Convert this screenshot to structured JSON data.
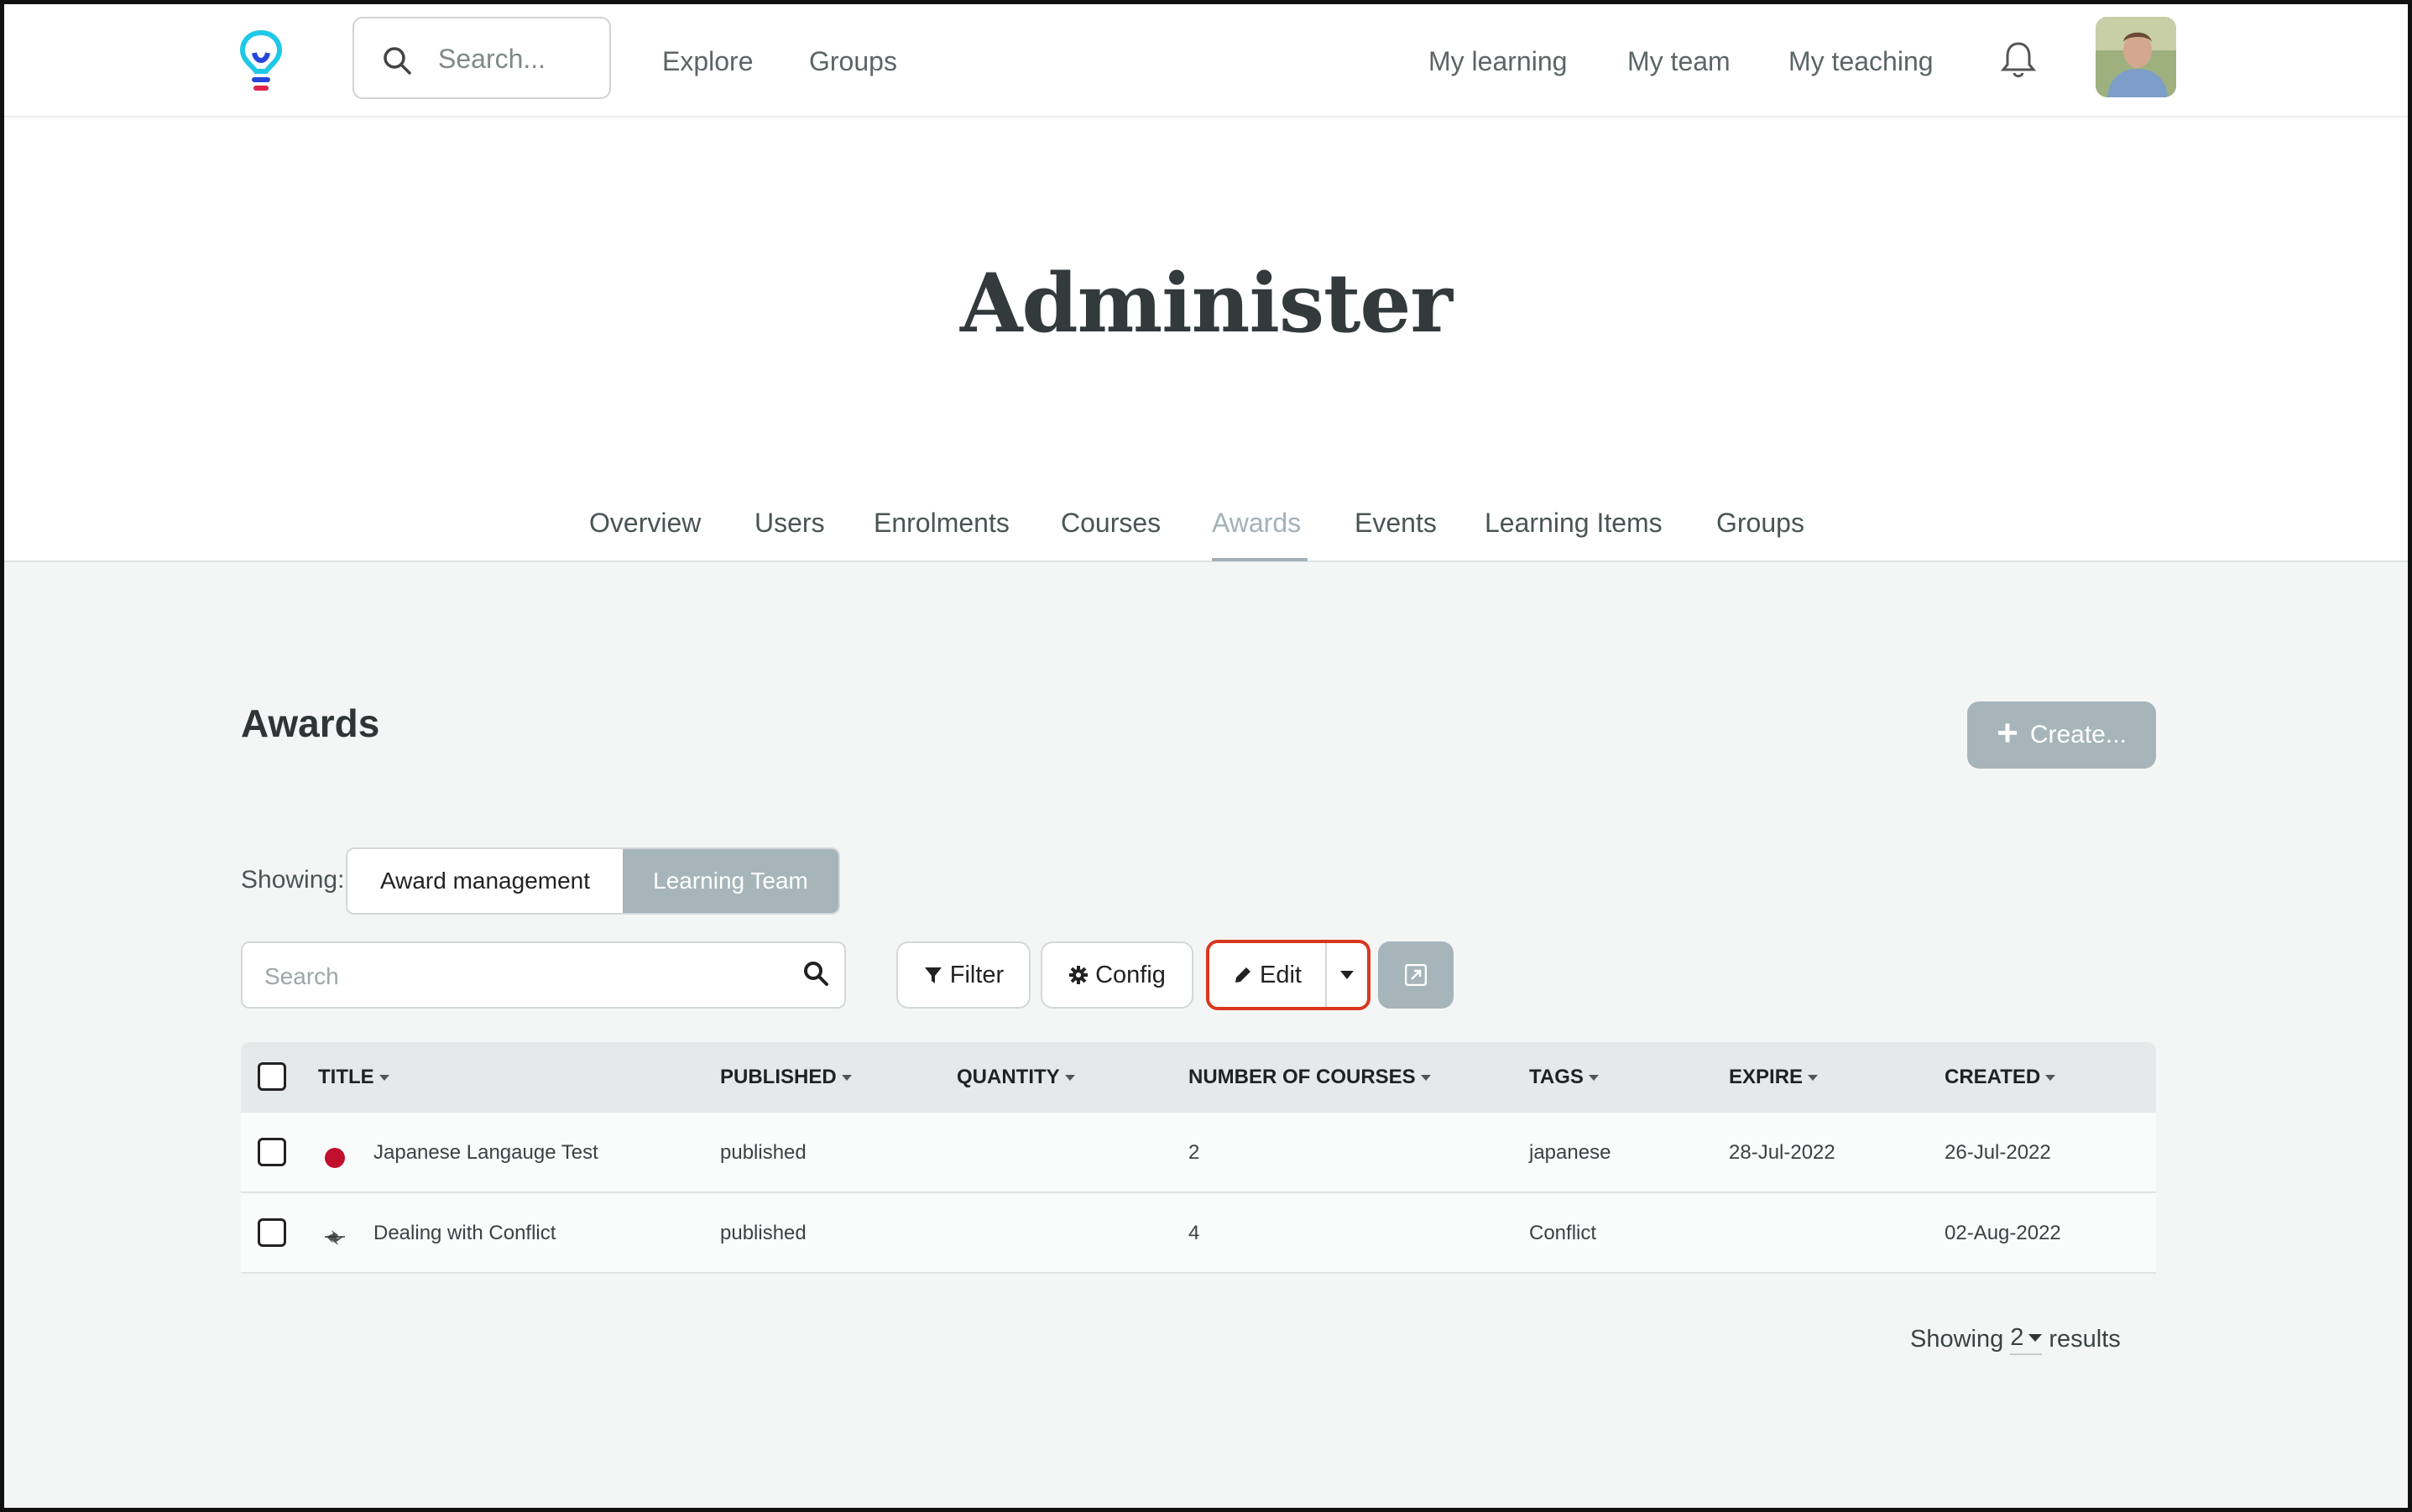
{
  "topbar": {
    "search_placeholder": "Search...",
    "nav_left": [
      "Explore",
      "Groups"
    ],
    "nav_right": [
      "My learning",
      "My team",
      "My teaching"
    ]
  },
  "header": {
    "title": "Administer",
    "tabs": [
      "Overview",
      "Users",
      "Enrolments",
      "Courses",
      "Awards",
      "Events",
      "Learning Items",
      "Groups"
    ],
    "active_tab": "Awards"
  },
  "awards": {
    "title": "Awards",
    "create_label": "Create...",
    "showing_label": "Showing:",
    "segments": [
      "Award management",
      "Learning Team"
    ],
    "search_placeholder": "Search",
    "filter_label": "Filter",
    "config_label": "Config",
    "edit_label": "Edit"
  },
  "table": {
    "columns": [
      "TITLE",
      "PUBLISHED",
      "QUANTITY",
      "NUMBER OF COURSES",
      "TAGS",
      "EXPIRE",
      "CREATED"
    ],
    "rows": [
      {
        "title": "Japanese Langauge Test",
        "published": "published",
        "quantity": "",
        "courses": "2",
        "tags": "japanese",
        "expire": "28-Jul-2022",
        "created": "26-Jul-2022",
        "icon": "japan-flag-icon"
      },
      {
        "title": "Dealing with Conflict",
        "published": "published",
        "quantity": "",
        "courses": "4",
        "tags": "Conflict",
        "expire": "",
        "created": "02-Aug-2022",
        "icon": "conflict-icon"
      }
    ]
  },
  "footer": {
    "showing_text": "Showing",
    "count": "2",
    "results_text": "results"
  },
  "colors": {
    "accent_muted": "#a6b5ba",
    "highlight_border": "#d9381e",
    "logo_cyan": "#1fc8e6",
    "logo_blue": "#2547d9",
    "logo_red": "#e0234b"
  }
}
